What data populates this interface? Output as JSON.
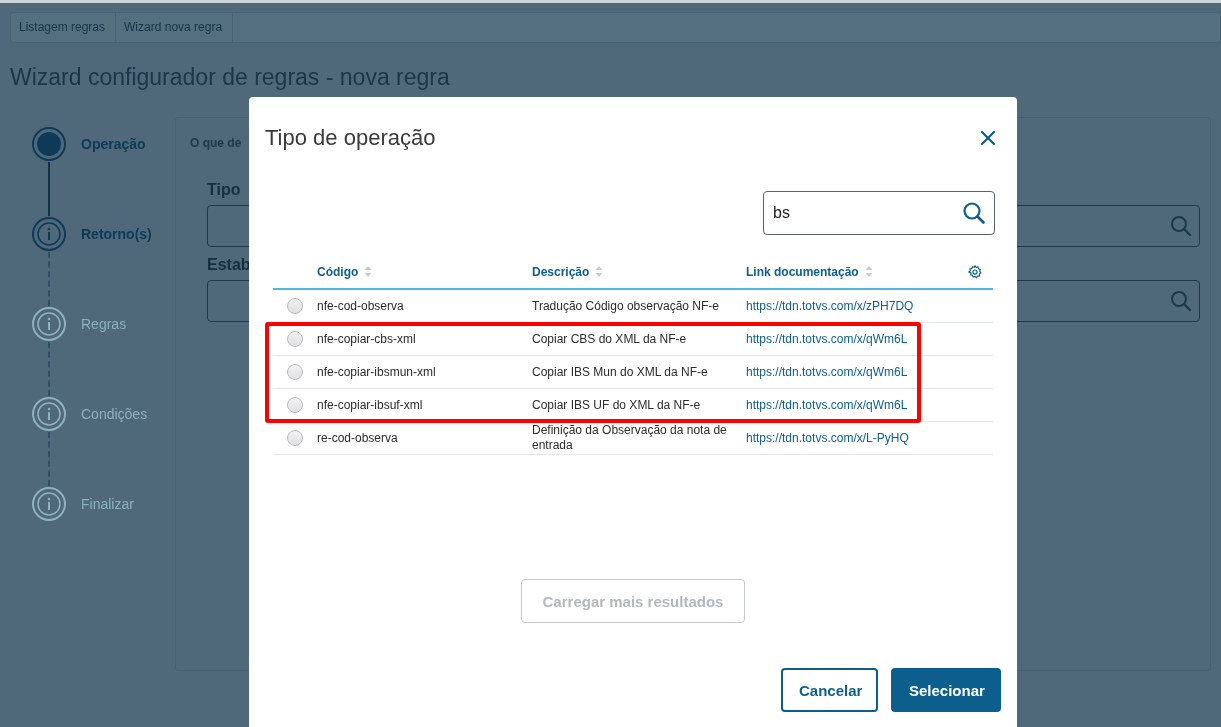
{
  "breadcrumb": [
    {
      "label": "Listagem regras"
    },
    {
      "label": "Wizard nova regra"
    }
  ],
  "page_title": "Wizard configurador de regras - nova regra",
  "steps": [
    {
      "label": "Operação",
      "current": true,
      "enabled": true
    },
    {
      "label": "Retorno(s)",
      "current": false,
      "enabled": true
    },
    {
      "label": "Regras",
      "current": false,
      "enabled": false
    },
    {
      "label": "Condições",
      "current": false,
      "enabled": false
    },
    {
      "label": "Finalizar",
      "current": false,
      "enabled": false
    }
  ],
  "form": {
    "intro": "O que de",
    "fields": [
      {
        "label": "Tipo"
      },
      {
        "label": "Estab"
      }
    ]
  },
  "dialog": {
    "title": "Tipo de operação",
    "search": {
      "value": "bs"
    },
    "columns": [
      "Código",
      "Descrição",
      "Link documentação"
    ],
    "rows": [
      {
        "code": "nfe-cod-observa",
        "description": "Tradução Código observação NF-e",
        "link": "https://tdn.totvs.com/x/zPH7DQ",
        "selected": false,
        "highlighted": false
      },
      {
        "code": "nfe-copiar-cbs-xml",
        "description": "Copiar CBS do XML da NF-e",
        "link": "https://tdn.totvs.com/x/qWm6L",
        "selected": false,
        "highlighted": true
      },
      {
        "code": "nfe-copiar-ibsmun-xml",
        "description": "Copiar IBS Mun do XML da NF-e",
        "link": "https://tdn.totvs.com/x/qWm6L",
        "selected": false,
        "highlighted": true
      },
      {
        "code": "nfe-copiar-ibsuf-xml",
        "description": "Copiar IBS UF do XML da NF-e",
        "link": "https://tdn.totvs.com/x/qWm6L",
        "selected": false,
        "highlighted": true
      },
      {
        "code": "re-cod-observa",
        "description": "Definição da Observação da nota de entrada",
        "link": "https://tdn.totvs.com/x/L-PyHQ",
        "selected": false,
        "highlighted": false
      }
    ],
    "load_more": {
      "label": "Carregar mais resultados",
      "disabled": true
    },
    "buttons": [
      {
        "label": "Cancelar",
        "kind": "secondary"
      },
      {
        "label": "Selecionar",
        "kind": "primary"
      }
    ]
  }
}
